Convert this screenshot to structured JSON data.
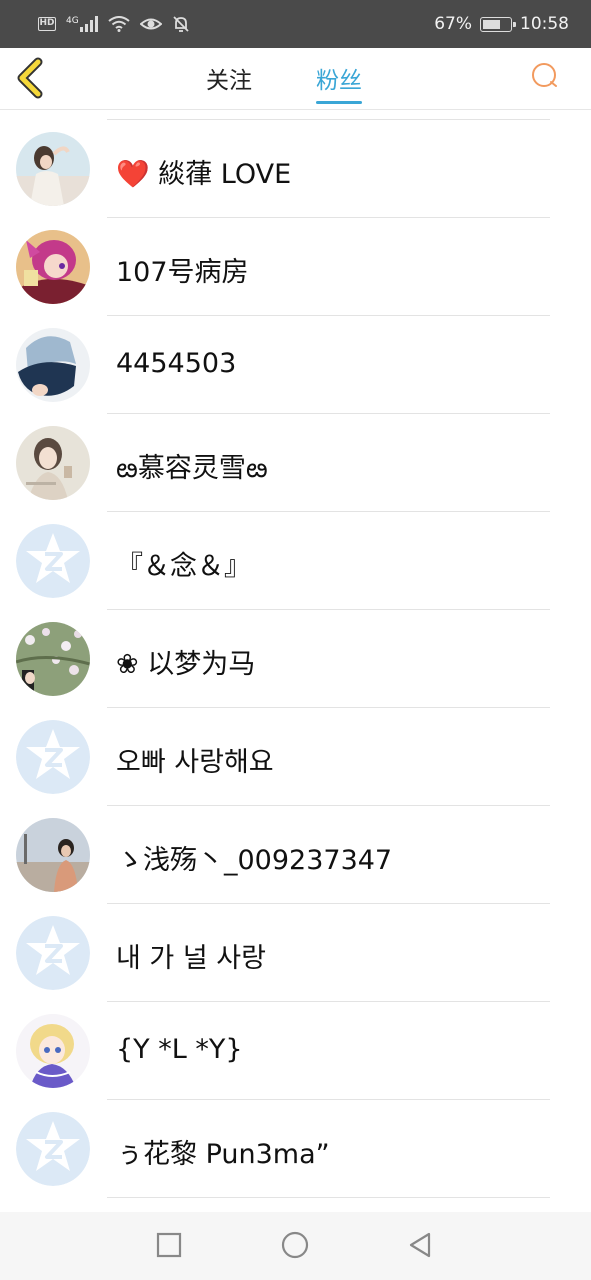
{
  "status_bar": {
    "hd": "HD",
    "network": "4G",
    "battery_level": "67%",
    "battery_fraction": 0.67,
    "time": "10:58",
    "icons": [
      "signal-icon",
      "wifi-icon",
      "eye-icon",
      "mute-bell-icon",
      "battery-icon"
    ]
  },
  "header": {
    "back_icon": "chevron-left-icon",
    "tabs": [
      {
        "label": "关注",
        "active": false
      },
      {
        "label": "粉丝",
        "active": true
      }
    ],
    "search_icon": "search-icon",
    "accent_color": "#3aa6d6",
    "back_color": "#f5d83a",
    "search_color": "#f29a5e"
  },
  "fans": [
    {
      "name": "❤️ 緂葎 LOVE",
      "avatar": "photo-girl"
    },
    {
      "name": "107号病房",
      "avatar": "anime-pink"
    },
    {
      "name": "4454503",
      "avatar": "photo-blue"
    },
    {
      "name": "ఴ慕容灵雪ఴ",
      "avatar": "photo-woman"
    },
    {
      "name": "『＆念＆』",
      "avatar": "default-z"
    },
    {
      "name": "❀ 以梦为马",
      "avatar": "photo-flowers"
    },
    {
      "name": "오빠 사랑해요",
      "avatar": "default-z"
    },
    {
      "name": "ゝ浅殇丶_009237347",
      "avatar": "photo-street"
    },
    {
      "name": "내 가 널 사랑",
      "avatar": "default-z"
    },
    {
      "name": "{Y *L *Y}",
      "avatar": "anime-blonde"
    },
    {
      "name": "ぅ花黎 Pun3ma”",
      "avatar": "default-z"
    }
  ],
  "nav_bar": {
    "icons": [
      "recent-apps-icon",
      "home-icon",
      "back-triangle-icon"
    ]
  }
}
